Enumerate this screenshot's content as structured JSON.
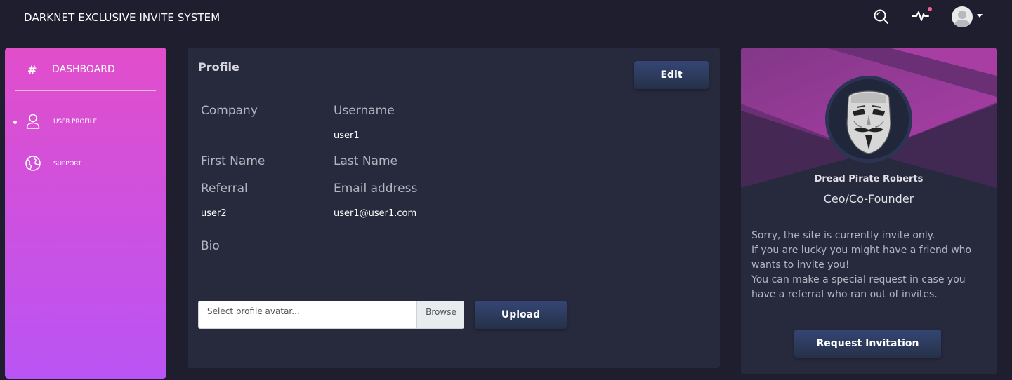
{
  "navbar": {
    "brand": "DARKNET EXCLUSIVE INVITE SYSTEM",
    "icons": [
      "search-icon",
      "pulse-icon",
      "avatar"
    ],
    "notification_color": "#fd5d93"
  },
  "sidebar": {
    "dashboard": {
      "icon": "#",
      "label": "DASHBOARD"
    },
    "items": [
      {
        "label": "USER PROFILE",
        "icon": "user-icon",
        "active": true
      },
      {
        "label": "SUPPORT",
        "icon": "globe-icon",
        "active": false
      }
    ],
    "gradient": [
      "#e14eca",
      "#ba54f5"
    ]
  },
  "profile": {
    "title": "Profile",
    "edit_label": "Edit",
    "fields": {
      "company": {
        "label": "Company",
        "value": ""
      },
      "username": {
        "label": "Username",
        "value": "user1"
      },
      "first_name": {
        "label": "First Name",
        "value": ""
      },
      "last_name": {
        "label": "Last Name",
        "value": ""
      },
      "referral": {
        "label": "Referral",
        "value": "user2"
      },
      "email": {
        "label": "Email address",
        "value": "user1@user1.com"
      },
      "bio": {
        "label": "Bio",
        "value": ""
      }
    },
    "avatar_input": {
      "placeholder": "Select profile avatar...",
      "browse_label": "Browse"
    },
    "upload_label": "Upload"
  },
  "user_card": {
    "name": "Dread Pirate Roberts",
    "role": "Ceo/Co-Founder",
    "description_lines": [
      "Sorry, the site is currently invite only.",
      "If you are lucky you might have a friend who",
      "wants to invite you!",
      "You can make a special request in case you",
      "have a referral who ran out of invites."
    ],
    "request_label": "Request Invitation"
  },
  "colors": {
    "background": "#1e1e2f",
    "card": "#27293d",
    "button": "#344675"
  }
}
